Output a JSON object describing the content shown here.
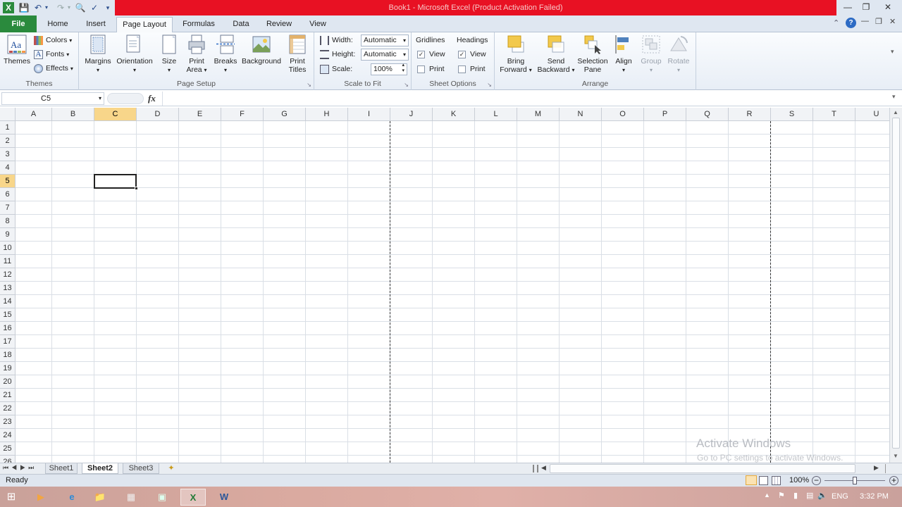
{
  "window": {
    "title": "Book1 - Microsoft Excel (Product Activation Failed)",
    "minimize_icon": "minimize-icon",
    "restore_icon": "restore-icon",
    "close_icon": "close-icon"
  },
  "ribbon_tabs": [
    "File",
    "Home",
    "Insert",
    "Page Layout",
    "Formulas",
    "Data",
    "Review",
    "View"
  ],
  "active_tab": "Page Layout",
  "ribbon": {
    "themes": {
      "themes_label": "Themes",
      "colors_label": "Colors",
      "fonts_label": "Fonts",
      "effects_label": "Effects",
      "group_label": "Themes"
    },
    "page_setup": {
      "margins": "Margins",
      "orientation": "Orientation",
      "size": "Size",
      "print_area_1": "Print",
      "print_area_2": "Area",
      "breaks": "Breaks",
      "background": "Background",
      "print_titles_1": "Print",
      "print_titles_2": "Titles",
      "group_label": "Page Setup"
    },
    "scale_to_fit": {
      "width_label": "Width:",
      "width_value": "Automatic",
      "height_label": "Height:",
      "height_value": "Automatic",
      "scale_label": "Scale:",
      "scale_value": "100%",
      "group_label": "Scale to Fit"
    },
    "sheet_options": {
      "gridlines_label": "Gridlines",
      "headings_label": "Headings",
      "view_label": "View",
      "print_label": "Print",
      "group_label": "Sheet Options"
    },
    "arrange": {
      "bring_forward_1": "Bring",
      "bring_forward_2": "Forward",
      "send_backward_1": "Send",
      "send_backward_2": "Backward",
      "selection_pane_1": "Selection",
      "selection_pane_2": "Pane",
      "align": "Align",
      "group": "Group",
      "rotate": "Rotate",
      "group_label": "Arrange"
    }
  },
  "formula_bar": {
    "name_box": "C5",
    "fx_label": "fx",
    "formula": ""
  },
  "columns": [
    "A",
    "B",
    "C",
    "D",
    "E",
    "F",
    "G",
    "H",
    "I",
    "J",
    "K",
    "L",
    "M",
    "N",
    "O",
    "P",
    "Q",
    "R",
    "S",
    "T",
    "U"
  ],
  "rows": [
    "1",
    "2",
    "3",
    "4",
    "5",
    "6",
    "7",
    "8",
    "9",
    "10",
    "11",
    "12",
    "13",
    "14",
    "15",
    "16",
    "17",
    "18",
    "19",
    "20",
    "21",
    "22",
    "23",
    "24",
    "25",
    "26"
  ],
  "selected_cell": {
    "column": "C",
    "row": "5"
  },
  "sheets": [
    "Sheet1",
    "Sheet2",
    "Sheet3"
  ],
  "active_sheet": "Sheet2",
  "status": {
    "ready": "Ready",
    "zoom": "100%"
  },
  "watermark": {
    "line1": "Activate Windows",
    "line2": "Go to PC settings to activate Windows."
  },
  "taskbar": {
    "language": "ENG",
    "time": "3:32 PM"
  },
  "colors": {
    "file_tab": "#2a8a3d",
    "title_bar": "#e81123",
    "selection_header": "#f8d68a"
  }
}
